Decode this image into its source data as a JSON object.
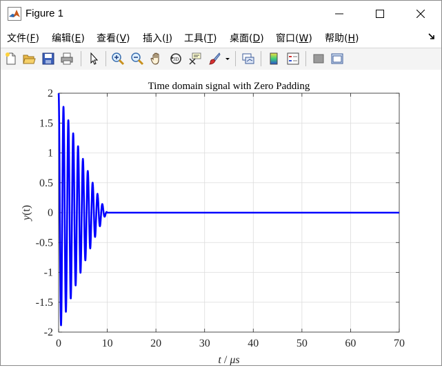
{
  "window": {
    "title": "Figure 1",
    "controls": {
      "minimize": "minimize",
      "maximize": "maximize",
      "close": "close"
    }
  },
  "menu": [
    {
      "label": "文件(",
      "key": "F",
      "tail": ")"
    },
    {
      "label": "编辑(",
      "key": "E",
      "tail": ")"
    },
    {
      "label": "查看(",
      "key": "V",
      "tail": ")"
    },
    {
      "label": "插入(",
      "key": "I",
      "tail": ")"
    },
    {
      "label": "工具(",
      "key": "T",
      "tail": ")"
    },
    {
      "label": "桌面(",
      "key": "D",
      "tail": ")"
    },
    {
      "label": "窗口(",
      "key": "W",
      "tail": ")"
    },
    {
      "label": "帮助(",
      "key": "H",
      "tail": ")"
    }
  ],
  "toolbar_icons": [
    "new-figure-icon",
    "open-file-icon",
    "save-icon",
    "print-icon",
    "select-arrow-icon",
    "zoom-in-icon",
    "zoom-out-icon",
    "pan-hand-icon",
    "rotate-3d-icon",
    "data-cursor-icon",
    "brush-icon",
    "brush-dropdown-icon",
    "link-plot-icon",
    "colorbar-icon",
    "legend-icon",
    "hide-plot-tools-icon",
    "show-plot-tools-icon"
  ],
  "chart_data": {
    "type": "line",
    "title": "Time domain signal with Zero Padding",
    "xlabel_var": "t",
    "xlabel_sep": " / ",
    "xlabel_unit": "μs",
    "ylabel_var": "y",
    "ylabel_arg": "(t)",
    "xlim": [
      0,
      70
    ],
    "ylim": [
      -2,
      2
    ],
    "xticks": [
      0,
      10,
      20,
      30,
      40,
      50,
      60,
      70
    ],
    "yticks": [
      -2,
      -1.5,
      -1,
      -0.5,
      0,
      0.5,
      1,
      1.5,
      2
    ],
    "ytick_labels": [
      "-2",
      "-1.5",
      "-1",
      "-0.5",
      "0",
      "0.5",
      "1",
      "1.5",
      "2"
    ],
    "grid": true,
    "series": [
      {
        "color": "#0000ff",
        "description_values": {
          "signal": "decaying oscillation",
          "amplitude_start": 2,
          "frequency_cycles_per_unit": 1,
          "oscillation_end": 10,
          "after_end_value": 0
        }
      }
    ]
  }
}
